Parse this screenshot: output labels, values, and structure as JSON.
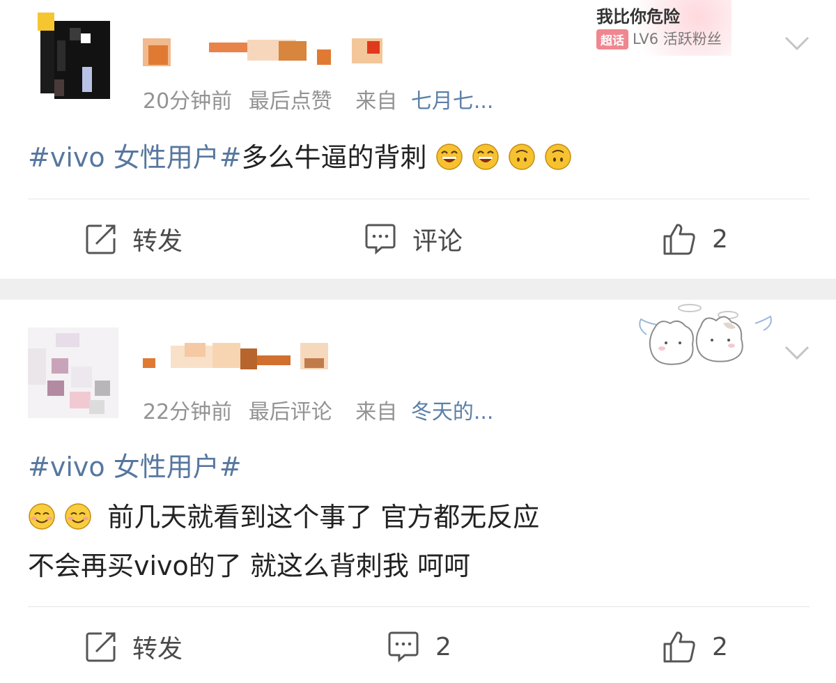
{
  "posts": [
    {
      "time": "20分钟前",
      "activity": "最后点赞",
      "source_label": "来自",
      "source": "七月七...",
      "topic": "#vivo 女性用户#",
      "body": "多么牛逼的背刺",
      "emojis": [
        "laughing-face-icon",
        "laughing-face-icon",
        "upside-down-face-icon",
        "upside-down-face-icon"
      ],
      "badge": {
        "title": "我比你危险",
        "tag": "超话",
        "level": "LV6 活跃粉丝"
      },
      "actions": {
        "repost": "转发",
        "comment": "评论",
        "like": "2"
      }
    },
    {
      "time": "22分钟前",
      "activity": "最后评论",
      "source_label": "来自",
      "source": "冬天的...",
      "topic": "#vivo 女性用户#",
      "line1": "前几天就看到这个事了 官方都无反应",
      "line2": "不会再买vivo的了 就这么背刺我 呵呵",
      "emojis": [
        "smiling-face-icon",
        "smiling-face-icon"
      ],
      "actions": {
        "repost": "转发",
        "comment": "2",
        "like": "2"
      }
    }
  ],
  "colors": {
    "topic": "#56779f",
    "meta": "#939393",
    "separator": "#efefef"
  }
}
